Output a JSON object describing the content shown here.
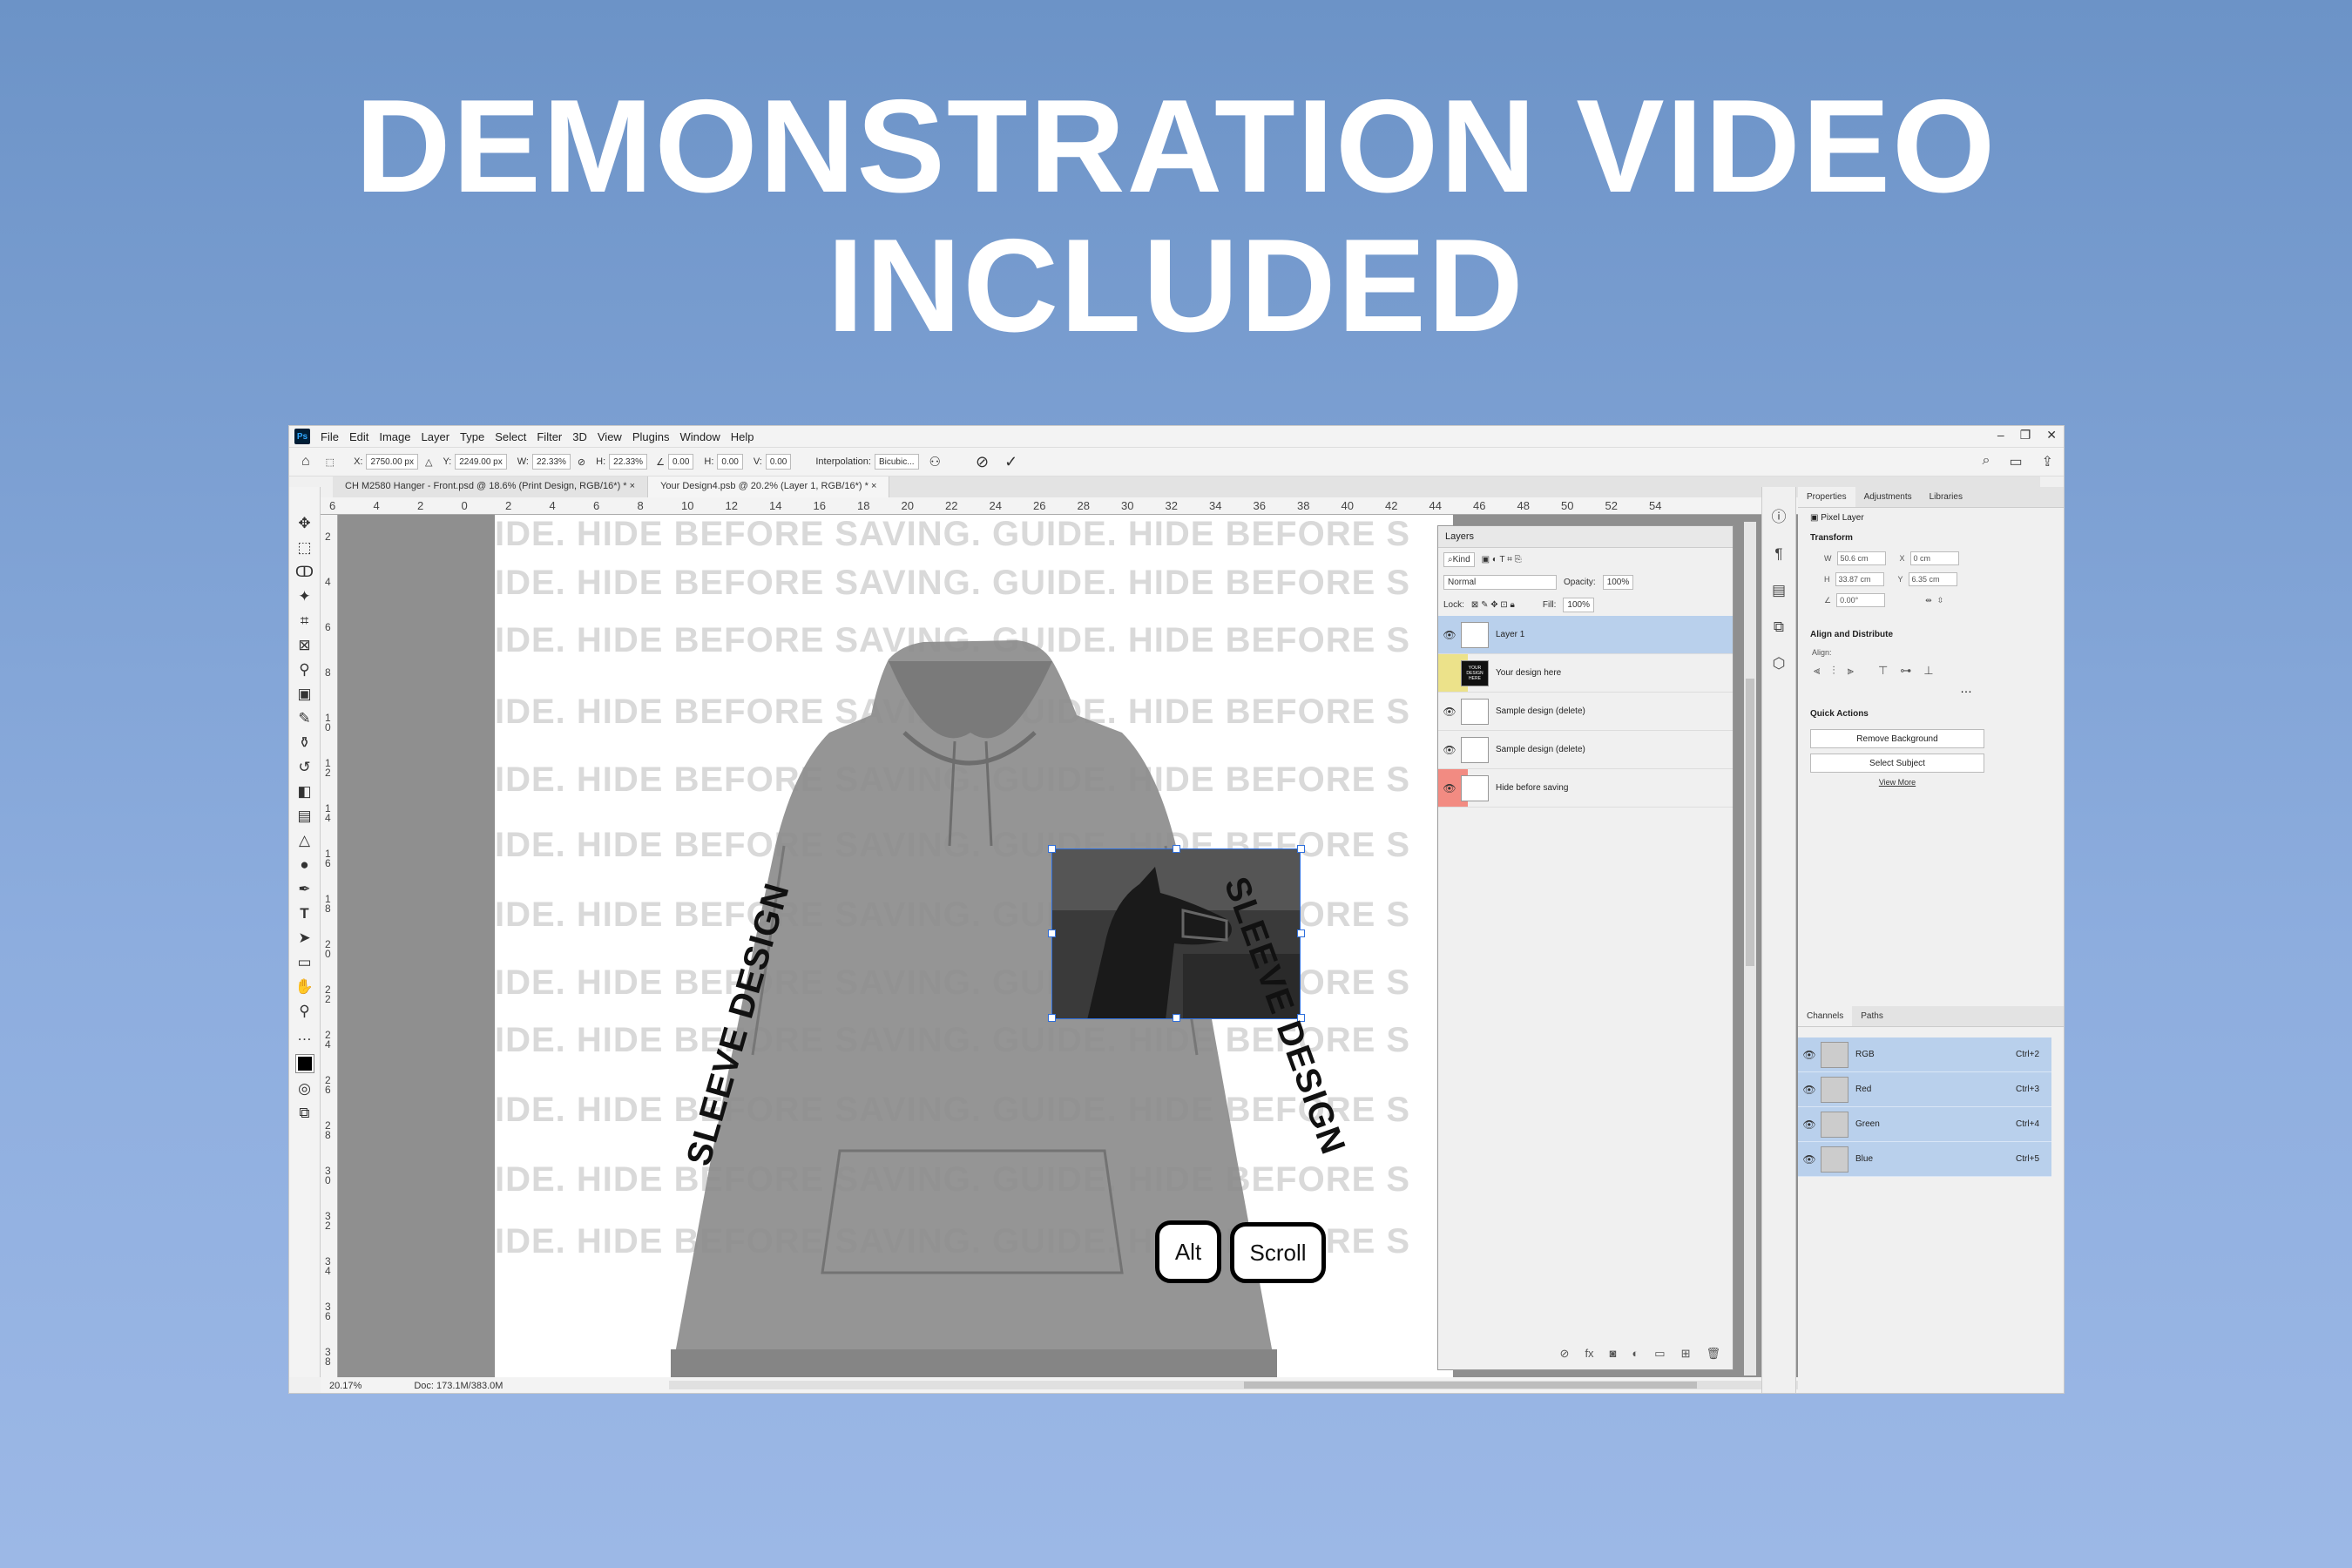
{
  "headline": {
    "line1": "DEMONSTRATION VIDEO",
    "line2": "INCLUDED"
  },
  "menubar": {
    "logo": "Ps",
    "items": [
      "File",
      "Edit",
      "Image",
      "Layer",
      "Type",
      "Select",
      "Filter",
      "3D",
      "View",
      "Plugins",
      "Window",
      "Help"
    ]
  },
  "options": {
    "x_label": "X:",
    "x": "2750.00 px",
    "y_label": "Y:",
    "y": "2249.00 px",
    "w_label": "W:",
    "w": "22.33%",
    "h_label": "H:",
    "h": "22.33%",
    "angle": "0.00",
    "hskew_label": "H:",
    "hskew": "0.00",
    "vskew_label": "V:",
    "vskew": "0.00",
    "interp_label": "Interpolation:",
    "interp": "Bicubic..."
  },
  "tabs": [
    "CH M2580 Hanger - Front.psd @ 18.6% (Print Design, RGB/16*) *",
    "Your Design4.psb @ 20.2% (Layer 1, RGB/16*) *"
  ],
  "ruler_h": [
    "6",
    "4",
    "2",
    "0",
    "2",
    "4",
    "6",
    "8",
    "10",
    "12",
    "14",
    "16",
    "18",
    "20",
    "22",
    "24",
    "26",
    "28",
    "30",
    "32",
    "34",
    "36",
    "38",
    "40",
    "42",
    "44",
    "46",
    "48",
    "50",
    "52",
    "54"
  ],
  "ruler_v": [
    "2",
    "4",
    "6",
    "8",
    "1\n0",
    "1\n2",
    "1\n4",
    "1\n6",
    "1\n8",
    "2\n0",
    "2\n2",
    "2\n4",
    "2\n6",
    "2\n8",
    "3\n0",
    "3\n2",
    "3\n4",
    "3\n6",
    "3\n8"
  ],
  "canvas": {
    "watermark": "IDE. HIDE BEFORE SAVING. GUIDE. HIDE BEFORE S",
    "sleeve_left": "SLEEVE DESIGN",
    "sleeve_right": "SLEEVE DESIGN",
    "key1": "Alt",
    "key2": "Scroll"
  },
  "layers": {
    "title": "Layers",
    "kind": "Kind",
    "blend": "Normal",
    "opacity_label": "Opacity:",
    "opacity": "100%",
    "lock_label": "Lock:",
    "fill_label": "Fill:",
    "fill": "100%",
    "items": [
      {
        "name": "Layer 1",
        "color": "#b9d0ec"
      },
      {
        "name": "Your design here",
        "color": "#ece28a",
        "thumb": "YOUR DESIGN HERE"
      },
      {
        "name": "Sample design (delete)",
        "color": ""
      },
      {
        "name": "Sample design (delete)",
        "color": ""
      },
      {
        "name": "Hide before saving",
        "color": "#f28b82"
      }
    ]
  },
  "status": {
    "zoom": "20.17%",
    "doc": "Doc: 173.1M/383.0M"
  },
  "properties": {
    "tabs": [
      "Properties",
      "Adjustments",
      "Libraries"
    ],
    "kind": "Pixel Layer",
    "transform": "Transform",
    "w_label": "W",
    "w": "50.6 cm",
    "x_label": "X",
    "x": "0 cm",
    "h_label": "H",
    "h": "33.87 cm",
    "y_label": "Y",
    "y": "6.35 cm",
    "angle": "0.00°",
    "align": "Align and Distribute",
    "align_label": "Align:",
    "quick": "Quick Actions",
    "remove_bg": "Remove Background",
    "select_subject": "Select Subject",
    "view_more": "View More"
  },
  "channels": {
    "tabs": [
      "Channels",
      "Paths"
    ],
    "items": [
      {
        "name": "RGB",
        "key": "Ctrl+2"
      },
      {
        "name": "Red",
        "key": "Ctrl+3"
      },
      {
        "name": "Green",
        "key": "Ctrl+4"
      },
      {
        "name": "Blue",
        "key": "Ctrl+5"
      }
    ]
  },
  "colors": {
    "accent": "#2f6fdc",
    "selected": "#b9d0ec",
    "background": "#7a9ed2"
  }
}
